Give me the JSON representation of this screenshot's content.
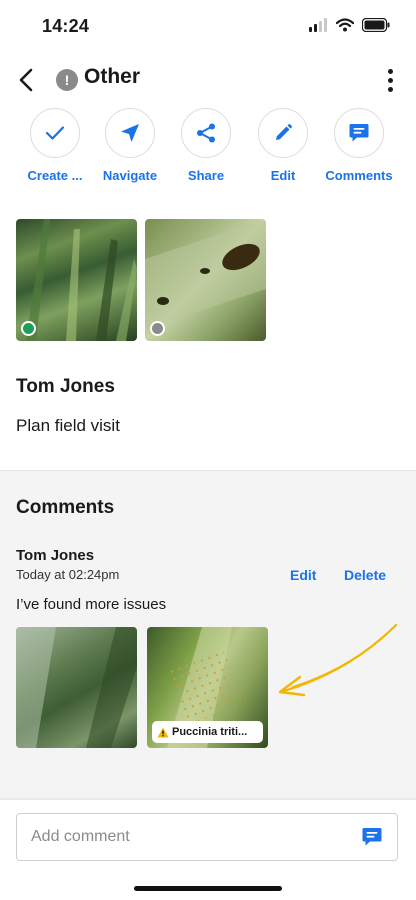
{
  "status_bar": {
    "time": "14:24"
  },
  "header": {
    "type_badge": "!",
    "title": "Other"
  },
  "actions": [
    {
      "label": "Create ...",
      "icon": "check-icon"
    },
    {
      "label": "Navigate",
      "icon": "navigate-arrow-icon"
    },
    {
      "label": "Share",
      "icon": "share-icon"
    },
    {
      "label": "Edit",
      "icon": "pencil-icon"
    },
    {
      "label": "Comments",
      "icon": "comment-icon"
    }
  ],
  "photos": [
    {
      "subject": "wheat field",
      "status_color": "#1aa05a"
    },
    {
      "subject": "leaf with insect",
      "status_color": "#8a8a8a"
    }
  ],
  "task": {
    "author": "Tom Jones",
    "note": "Plan field visit"
  },
  "comments": {
    "title": "Comments",
    "items": [
      {
        "author": "Tom Jones",
        "time": "Today at 02:24pm",
        "edit_label": "Edit",
        "delete_label": "Delete",
        "text": "I’ve found more issues",
        "photos": [
          {
            "subject": "leaf close-up",
            "tag": ""
          },
          {
            "subject": "rust-infected leaf",
            "tag": "Puccinia triti..."
          }
        ]
      }
    ]
  },
  "footer": {
    "placeholder": "Add comment"
  },
  "colors": {
    "accent": "#1a73e8",
    "arrow": "#f2b705",
    "warning": "#f2b705"
  }
}
